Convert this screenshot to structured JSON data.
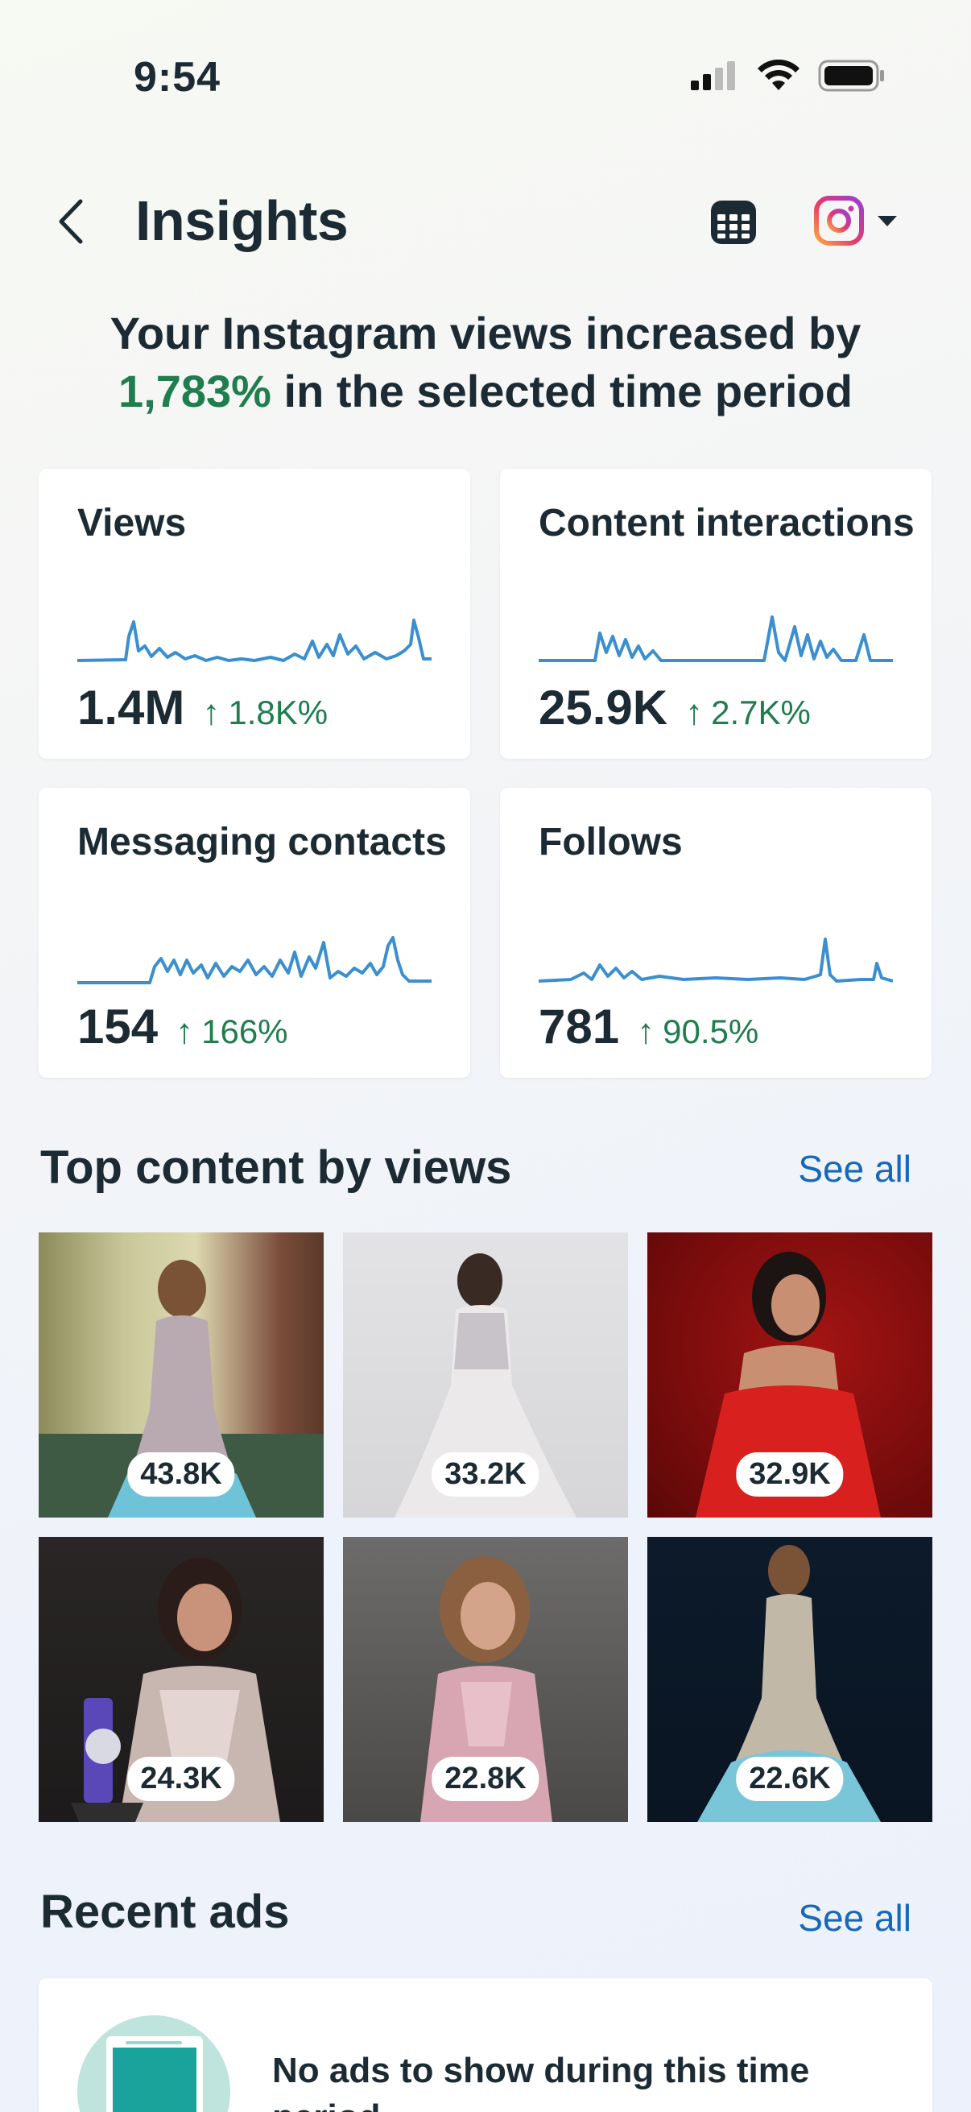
{
  "status_bar": {
    "time": "9:54"
  },
  "header": {
    "title": "Insights"
  },
  "summary": {
    "prefix": "Your Instagram views increased by",
    "percent": "1,783%",
    "suffix": "in the selected time period"
  },
  "metrics": [
    {
      "label": "Views",
      "value": "1.4M",
      "arrow": "↑",
      "change": "1.8K%"
    },
    {
      "label": "Content interactions",
      "value": "25.9K",
      "arrow": "↑",
      "change": "2.7K%"
    },
    {
      "label": "Messaging contacts",
      "value": "154",
      "arrow": "↑",
      "change": "166%"
    },
    {
      "label": "Follows",
      "value": "781",
      "arrow": "↑",
      "change": "90.5%"
    }
  ],
  "top_content": {
    "title": "Top content by views",
    "see_all": "See all",
    "items": [
      {
        "views": "43.8K"
      },
      {
        "views": "33.2K"
      },
      {
        "views": "32.9K"
      },
      {
        "views": "24.3K"
      },
      {
        "views": "22.8K"
      },
      {
        "views": "22.6K"
      }
    ]
  },
  "recent_ads": {
    "title": "Recent ads",
    "see_all": "See all",
    "empty_text": "No ads to show during this time period"
  },
  "colors": {
    "accent_green": "#1f7d4e",
    "link_blue": "#1768b8",
    "spark_blue": "#3b8fcf"
  }
}
